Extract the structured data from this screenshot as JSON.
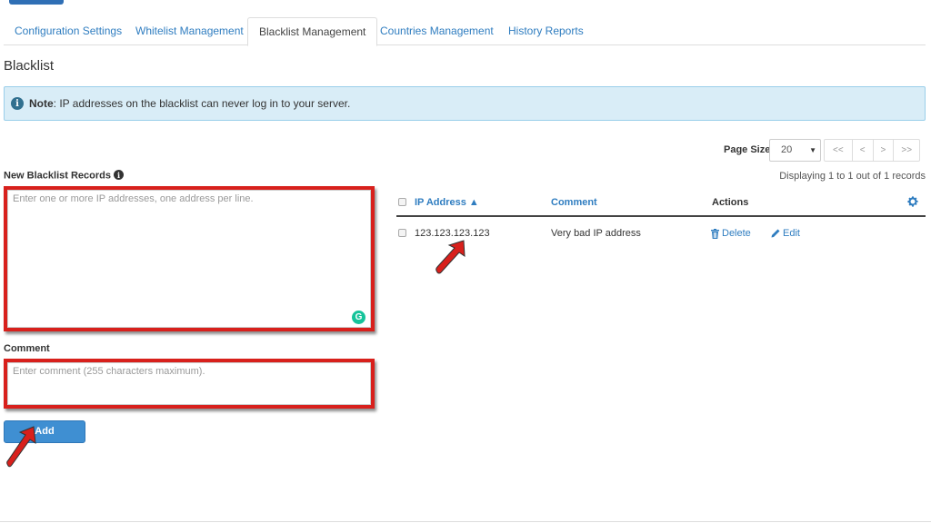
{
  "tabs": [
    {
      "label": "Configuration Settings",
      "active": false
    },
    {
      "label": "Whitelist Management",
      "active": false
    },
    {
      "label": "Blacklist Management",
      "active": true
    },
    {
      "label": "Countries Management",
      "active": false
    },
    {
      "label": "History Reports",
      "active": false
    }
  ],
  "page": {
    "title": "Blacklist"
  },
  "note": {
    "label": "Note",
    "text": ": IP addresses on the blacklist can never log in to your server."
  },
  "form": {
    "records_label": "New Blacklist Records",
    "records_placeholder": "Enter one or more IP addresses, one address per line.",
    "comment_label": "Comment",
    "comment_placeholder": "Enter comment (255 characters maximum).",
    "add_label": "Add"
  },
  "pager": {
    "page_size_label": "Page Size",
    "page_size_value": "20",
    "buttons": [
      "<<",
      "<",
      ">",
      ">>"
    ],
    "displaying": "Displaying 1 to 1 out of 1 records"
  },
  "table": {
    "columns": {
      "ip": "IP Address ▲",
      "comment": "Comment",
      "actions": "Actions"
    },
    "rows": [
      {
        "ip": "123.123.123.123",
        "comment": "Very bad IP address",
        "delete_label": "Delete",
        "edit_label": "Edit"
      }
    ]
  },
  "colors": {
    "highlight": "#d8201c",
    "link": "#2f7dc0",
    "note_bg": "#d9edf7",
    "button": "#3f8fd2"
  },
  "icons": {
    "note": "info-circle-icon",
    "help": "info-circle-icon",
    "grammarly": "grammarly-icon",
    "settings": "gear-icon",
    "delete": "trash-icon",
    "edit": "pencil-icon",
    "annotation": "red-arrow-icon"
  }
}
